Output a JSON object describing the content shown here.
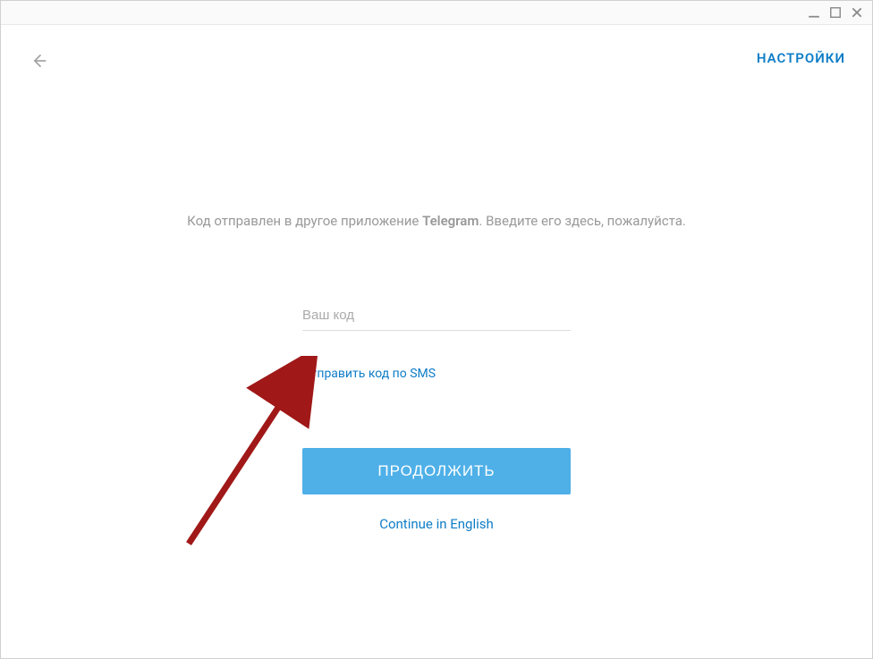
{
  "header": {
    "settings_label": "НАСТРОЙКИ"
  },
  "instruction": {
    "text_before": "Код отправлен в другое приложение ",
    "app_name": "Telegram",
    "text_after": ". Введите его здесь, пожалуйста."
  },
  "form": {
    "code_placeholder": "Ваш код",
    "sms_link_label": "Отправить код по SMS",
    "continue_button_label": "ПРОДОЛЖИТЬ",
    "english_link_label": "Continue in English"
  },
  "colors": {
    "accent": "#0f7dc7",
    "button": "#4fb0e8",
    "muted_text": "#999"
  }
}
